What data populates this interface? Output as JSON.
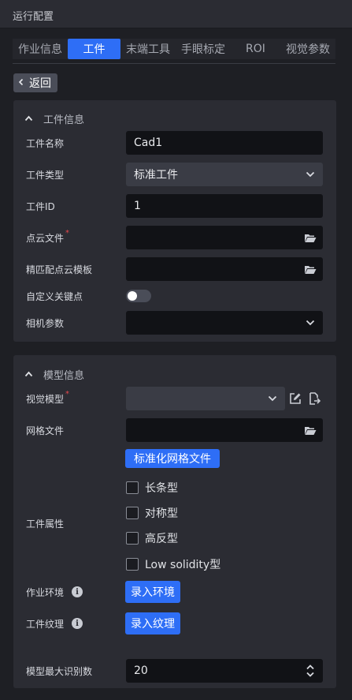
{
  "window": {
    "title": "运行配置"
  },
  "tabs": [
    {
      "label": "作业信息",
      "active": false
    },
    {
      "label": "工件",
      "active": true
    },
    {
      "label": "末端工具",
      "active": false
    },
    {
      "label": "手眼标定",
      "active": false
    },
    {
      "label": "ROI",
      "active": false
    },
    {
      "label": "视觉参数",
      "active": false
    }
  ],
  "back_button": {
    "label": "返回"
  },
  "workpiece_info": {
    "title": "工件信息",
    "name_label": "工件名称",
    "name_value": "Cad1",
    "type_label": "工件类型",
    "type_value": "标准工件",
    "id_label": "工件ID",
    "id_value": "1",
    "point_cloud_label": "点云文件",
    "point_cloud_value": "",
    "template_label": "精匹配点云模板",
    "template_value": "",
    "custom_keypoint_label": "自定义关键点",
    "custom_keypoint_on": false,
    "camera_params_label": "相机参数",
    "camera_params_value": ""
  },
  "model_info": {
    "title": "模型信息",
    "vision_model_label": "视觉模型",
    "vision_model_value": "",
    "mesh_file_label": "网格文件",
    "mesh_file_value": "",
    "standardize_button": "标准化网格文件",
    "attributes_label": "工件属性",
    "attributes": [
      {
        "label": "长条型",
        "checked": false
      },
      {
        "label": "对称型",
        "checked": false
      },
      {
        "label": "高反型",
        "checked": false
      },
      {
        "label": "Low solidity型",
        "checked": false
      }
    ],
    "environment_label": "作业环境",
    "environment_button": "录入环境",
    "texture_label": "工件纹理",
    "texture_button": "录入纹理",
    "max_detect_label": "模型最大识别数",
    "max_detect_value": "20"
  },
  "colors": {
    "accent": "#2e6ef6",
    "background": "#1e1f24",
    "panel": "#2b2c33",
    "field": "#111216",
    "required": "#e5484d"
  }
}
